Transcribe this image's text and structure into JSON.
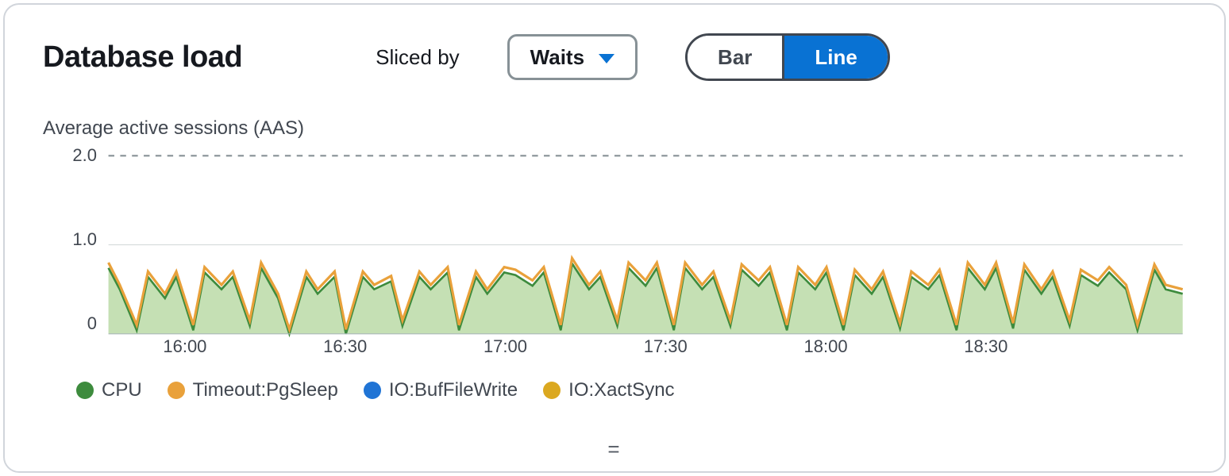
{
  "header": {
    "title": "Database load",
    "sliced_by_label": "Sliced by",
    "dropdown_value": "Waits",
    "toggle": {
      "bar": "Bar",
      "line": "Line",
      "active": "line"
    }
  },
  "subtitle": "Average active sessions (AAS)",
  "legend": [
    {
      "label": "CPU",
      "color": "#3d8b3d"
    },
    {
      "label": "Timeout:PgSleep",
      "color": "#e9a13b"
    },
    {
      "label": "IO:BufFileWrite",
      "color": "#2074d5"
    },
    {
      "label": "IO:XactSync",
      "color": "#dba820"
    }
  ],
  "chart_data": {
    "type": "area",
    "ylabel": "Average active sessions (AAS)",
    "ylim": [
      0,
      2.0
    ],
    "yticks": [
      0,
      1.0,
      2.0
    ],
    "xlabel": "",
    "xticks": [
      "16:00",
      "16:30",
      "17:00",
      "17:30",
      "18:00",
      "18:30"
    ],
    "xlim_minutes": [
      945,
      1135
    ],
    "max_line": 2.0,
    "series": [
      {
        "name": "CPU",
        "color": "#3d8b3d",
        "fill": "#c5e0b4"
      },
      {
        "name": "Timeout:PgSleep",
        "color": "#e9a13b",
        "fill": "none"
      },
      {
        "name": "IO:BufFileWrite",
        "color": "#2074d5",
        "fill": "none"
      },
      {
        "name": "IO:XactSync",
        "color": "#dba820",
        "fill": "none"
      }
    ],
    "x_minutes": [
      945,
      947,
      950,
      952,
      955,
      957,
      960,
      962,
      965,
      967,
      970,
      972,
      975,
      977,
      980,
      982,
      985,
      987,
      990,
      992,
      995,
      997,
      1000,
      1002,
      1005,
      1007,
      1010,
      1012,
      1015,
      1017,
      1020,
      1022,
      1025,
      1027,
      1030,
      1032,
      1035,
      1037,
      1040,
      1042,
      1045,
      1047,
      1050,
      1052,
      1055,
      1057,
      1060,
      1062,
      1065,
      1067,
      1070,
      1072,
      1075,
      1077,
      1080,
      1082,
      1085,
      1087,
      1090,
      1092,
      1095,
      1097,
      1100,
      1102,
      1105,
      1107,
      1110,
      1112,
      1115,
      1117,
      1120,
      1122,
      1125,
      1127,
      1130,
      1132,
      1135
    ],
    "stacked_top": [
      0.8,
      0.55,
      0.1,
      0.7,
      0.45,
      0.7,
      0.1,
      0.75,
      0.55,
      0.7,
      0.15,
      0.8,
      0.45,
      0.05,
      0.7,
      0.5,
      0.7,
      0.05,
      0.7,
      0.55,
      0.65,
      0.15,
      0.7,
      0.55,
      0.75,
      0.1,
      0.7,
      0.5,
      0.75,
      0.72,
      0.6,
      0.75,
      0.1,
      0.85,
      0.55,
      0.7,
      0.15,
      0.8,
      0.6,
      0.8,
      0.1,
      0.8,
      0.55,
      0.7,
      0.15,
      0.78,
      0.6,
      0.75,
      0.1,
      0.75,
      0.55,
      0.75,
      0.1,
      0.72,
      0.5,
      0.7,
      0.12,
      0.7,
      0.55,
      0.72,
      0.1,
      0.8,
      0.55,
      0.8,
      0.12,
      0.78,
      0.5,
      0.7,
      0.15,
      0.72,
      0.6,
      0.75,
      0.55,
      0.1,
      0.78,
      0.55,
      0.5
    ],
    "cpu_values": [
      0.74,
      0.5,
      0.04,
      0.64,
      0.4,
      0.64,
      0.04,
      0.69,
      0.5,
      0.64,
      0.09,
      0.74,
      0.4,
      0.0,
      0.64,
      0.45,
      0.64,
      0.0,
      0.64,
      0.5,
      0.59,
      0.09,
      0.64,
      0.5,
      0.69,
      0.04,
      0.64,
      0.45,
      0.69,
      0.66,
      0.54,
      0.69,
      0.04,
      0.79,
      0.5,
      0.64,
      0.09,
      0.74,
      0.54,
      0.74,
      0.04,
      0.74,
      0.5,
      0.64,
      0.09,
      0.72,
      0.54,
      0.69,
      0.04,
      0.69,
      0.5,
      0.69,
      0.04,
      0.66,
      0.45,
      0.64,
      0.06,
      0.64,
      0.5,
      0.66,
      0.04,
      0.74,
      0.5,
      0.74,
      0.06,
      0.72,
      0.45,
      0.64,
      0.09,
      0.66,
      0.54,
      0.69,
      0.5,
      0.04,
      0.72,
      0.5,
      0.45
    ]
  },
  "drag_handle_glyph": "="
}
